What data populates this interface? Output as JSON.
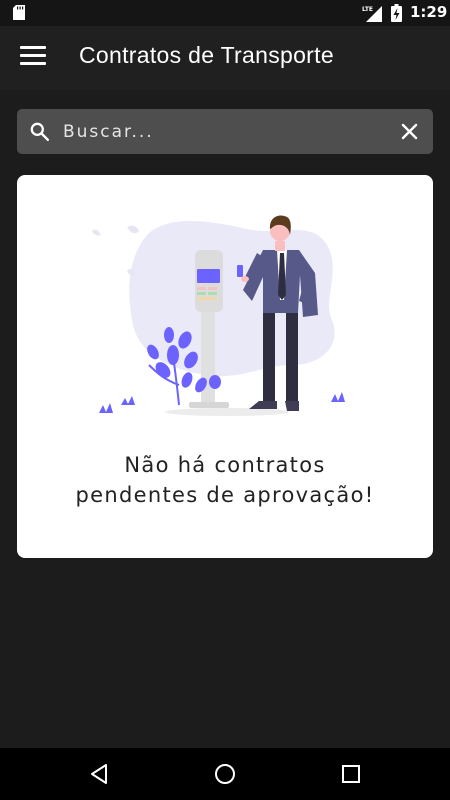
{
  "status_bar": {
    "network": "LTE",
    "time": "1:29"
  },
  "app_bar": {
    "title": "Contratos de Transporte",
    "menu_icon": "hamburger-menu-icon"
  },
  "search": {
    "placeholder": "Buscar...",
    "value": "",
    "search_icon": "search-icon",
    "clear_icon": "close-icon"
  },
  "empty_state": {
    "message_line1": "Não há contratos",
    "message_line2": "pendentes de aprovação!",
    "illustration": "man-with-phone-at-payment-terminal-illustration"
  },
  "nav_bar": {
    "back_icon": "back-triangle-icon",
    "home_icon": "home-circle-icon",
    "recents_icon": "recents-square-icon"
  },
  "colors": {
    "background": "#1c1c1c",
    "app_bar": "#202020",
    "search_bar": "#4e4e4e",
    "card": "#ffffff",
    "accent": "#6c63ff",
    "text_dark": "#222222"
  }
}
